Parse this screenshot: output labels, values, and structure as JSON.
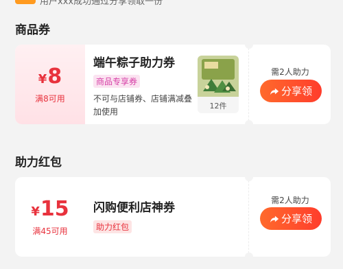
{
  "top_strip": {
    "text": "用户xxx成功通过分享领取一份"
  },
  "sections": [
    {
      "title": "商品券",
      "card": {
        "currency": "¥",
        "amount": "8",
        "condition": "满8可用",
        "title": "端午粽子助力券",
        "tag": "商品专享券",
        "desc": "不可与店铺券、店铺满减叠加使用",
        "product_count": "12件",
        "help_text": "需2人助力",
        "button": "分享领"
      }
    },
    {
      "title": "助力红包",
      "card": {
        "currency": "¥",
        "amount": "15",
        "condition": "满45可用",
        "title": "闪购便利店神券",
        "tag": "助力红包",
        "help_text": "需2人助力",
        "button": "分享领"
      }
    }
  ],
  "colors": {
    "accent": "#e8323d",
    "button_start": "#ff6a2c",
    "button_end": "#ff3d2c",
    "tag_pink": "#d63fa6"
  },
  "icons": [
    "share-icon",
    "zongzi-product-thumbnail"
  ]
}
